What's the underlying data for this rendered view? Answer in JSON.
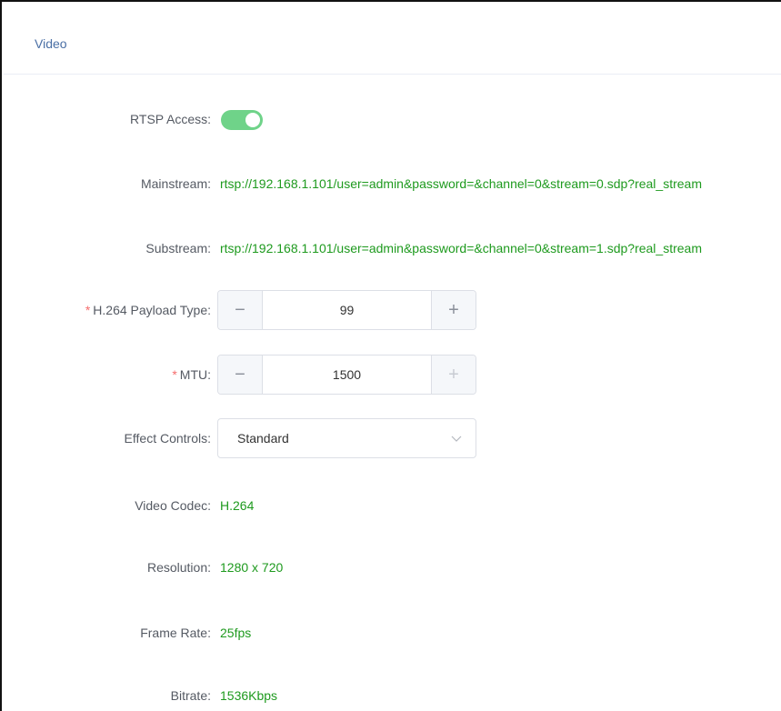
{
  "panel": {
    "title": "Video"
  },
  "rtsp_access": {
    "label": "RTSP Access:",
    "enabled": true,
    "accent_color": "#6fd389"
  },
  "mainstream": {
    "label": "Mainstream:",
    "value": "rtsp://192.168.1.101/user=admin&password=&channel=0&stream=0.sdp?real_stream"
  },
  "substream": {
    "label": "Substream:",
    "value": "rtsp://192.168.1.101/user=admin&password=&channel=0&stream=1.sdp?real_stream"
  },
  "payload_type": {
    "required_mark": "*",
    "label": "H.264 Payload Type:",
    "value": "99",
    "minus": "−",
    "plus": "+"
  },
  "mtu": {
    "required_mark": "*",
    "label": "MTU:",
    "value": "1500",
    "minus": "−",
    "plus": "+"
  },
  "effect_controls": {
    "label": "Effect Controls:",
    "selected": "Standard",
    "icon": "chevron-down-icon"
  },
  "video_codec": {
    "label": "Video Codec:",
    "value": "H.264"
  },
  "resolution": {
    "label": "Resolution:",
    "value": "1280 x 720"
  },
  "frame_rate": {
    "label": "Frame Rate:",
    "value": "25fps"
  },
  "bitrate": {
    "label": "Bitrate:",
    "value": "1536Kbps"
  },
  "colors": {
    "value_green": "#1e9a1e",
    "required_red": "#f56c6c",
    "header_blue": "#4a6fa5"
  }
}
